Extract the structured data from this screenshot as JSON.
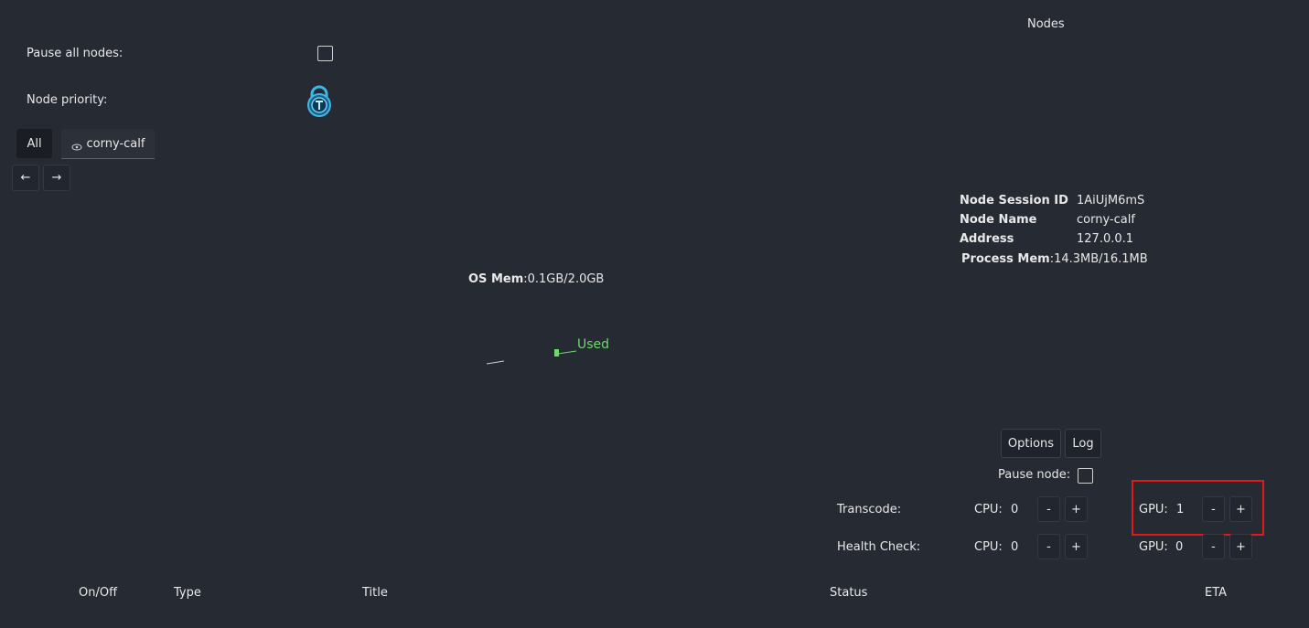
{
  "header": {
    "title": "Nodes"
  },
  "controls": {
    "pause_all_label": "Pause all nodes:",
    "node_priority_label": "Node priority:"
  },
  "tabs": [
    {
      "label": "All"
    },
    {
      "label": "corny-calf"
    }
  ],
  "nav": {
    "prev": "←",
    "next": "→"
  },
  "node_info": {
    "session_id_label": "Node Session ID",
    "session_id": "1AiUjM6mS",
    "name_label": "Node Name",
    "name": "corny-calf",
    "address_label": "Address",
    "address": "127.0.0.1",
    "process_mem_label": "Process Mem",
    "process_mem": ":14.3MB/16.1MB"
  },
  "os_mem": {
    "label": "OS Mem",
    "value": ":0.1GB/2.0GB",
    "used_label": "Used",
    "used_color": "#6fd86f"
  },
  "actions": {
    "options": "Options",
    "log": "Log",
    "pause_node_label": "Pause node:"
  },
  "workers": {
    "transcode": {
      "label": "Transcode:",
      "cpu_label": "CPU:",
      "cpu_value": "0",
      "gpu_label": "GPU:",
      "gpu_value": "1"
    },
    "health_check": {
      "label": "Health Check:",
      "cpu_label": "CPU:",
      "cpu_value": "0",
      "gpu_label": "GPU:",
      "gpu_value": "0"
    },
    "minus": "-",
    "plus": "+"
  },
  "table": {
    "columns": [
      "On/Off",
      "Type",
      "Title",
      "Status",
      "ETA"
    ]
  },
  "highlight_color": "#e0191b"
}
